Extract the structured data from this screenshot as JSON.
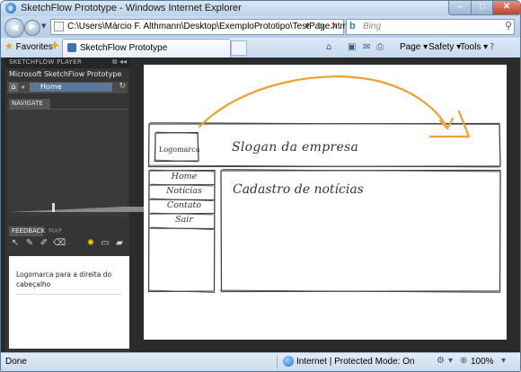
{
  "window": {
    "title": "SketchFlow Prototype - Windows Internet Explorer"
  },
  "address_bar": {
    "url": "C:\\Users\\Márcio F. Althmann\\Desktop\\ExemploPrototipo\\TestPage.html",
    "search_placeholder": "Bing"
  },
  "favorites_bar": {
    "favorites_label": "Favorites",
    "tab_label": "SketchFlow Prototype",
    "commands": [
      "Page",
      "Safety",
      "Tools"
    ]
  },
  "sketchflow_player": {
    "header": "SKETCHFLOW PLAYER",
    "project_title": "Microsoft SketchFlow Prototype",
    "current_screen": "Home",
    "navigate_tab": "NAVIGATE",
    "feedback_tab": "FEEDBACK",
    "map_tab": "MAP",
    "feedback_text": "Logomarca para a direita do cabeçalho"
  },
  "prototype": {
    "logo_label": "Logomarca",
    "slogan": "Slogan da empresa",
    "menu": [
      "Home",
      "Notícias",
      "Contato",
      "Sair"
    ],
    "content_title": "Cadastro de notícias",
    "annotation_color": "#f0a030"
  },
  "status_bar": {
    "status": "Done",
    "zone": "Internet | Protected Mode: On",
    "zoom": "100%"
  }
}
